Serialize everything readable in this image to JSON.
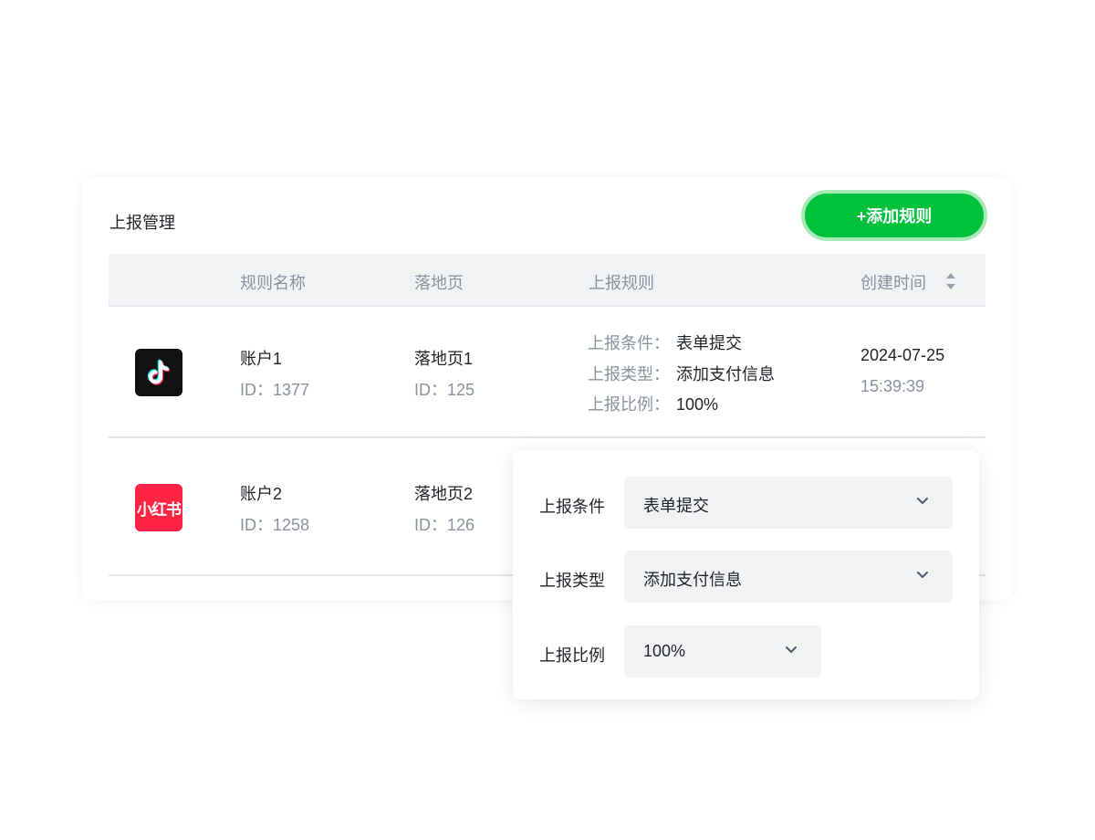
{
  "card": {
    "title": "上报管理",
    "add_button": "+添加规则"
  },
  "table": {
    "columns": [
      "规则名称",
      "落地页",
      "上报规则",
      "创建时间"
    ],
    "rows": [
      {
        "platform_icon": "tiktok-icon",
        "account_name": "账户1",
        "account_id": "ID：1377",
        "landing_page": "落地页1",
        "landing_id": "ID：125",
        "rules": [
          {
            "key": "上报条件：",
            "value": "表单提交"
          },
          {
            "key": "上报类型：",
            "value": "添加支付信息"
          },
          {
            "key": "上报比例：",
            "value": "100%"
          }
        ],
        "created_date": "2024-07-25",
        "created_time": "15:39:39"
      },
      {
        "platform_icon": "xiaohongshu-icon",
        "platform_logo_text": "小红书",
        "account_name": "账户2",
        "account_id": "ID：1258",
        "landing_page": "落地页2",
        "landing_id": "ID：126"
      }
    ]
  },
  "popover": {
    "fields": [
      {
        "label": "上报条件",
        "value": "表单提交"
      },
      {
        "label": "上报类型",
        "value": "添加支付信息"
      },
      {
        "label": "上报比例",
        "value": "100%"
      }
    ]
  },
  "colors": {
    "accent_green": "#00c13b",
    "accent_green_ring": "#a8eab7",
    "header_bg": "#f2f3f5",
    "muted_text": "#8a919f",
    "xiaohongshu_red": "#ff2442"
  }
}
